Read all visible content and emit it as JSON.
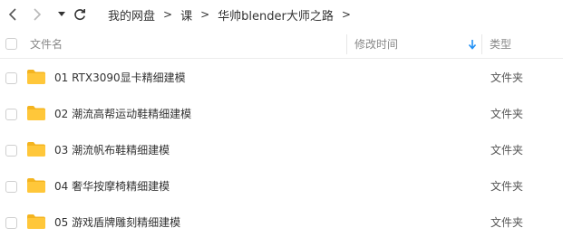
{
  "nav": {
    "back_icon": "chevron-left-icon",
    "forward_icon": "chevron-right-icon",
    "dropdown_icon": "caret-down-icon",
    "refresh_icon": "refresh-icon"
  },
  "breadcrumb": {
    "items": [
      "我的网盘",
      "课",
      "华帅blender大师之路"
    ],
    "separator": ">"
  },
  "columns": {
    "name": "文件名",
    "modified": "修改时间",
    "type": "类型",
    "sort_icon": "sort-down-arrow-icon",
    "sort_color": "#1e8ff5"
  },
  "files": [
    {
      "name": "01 RTX3090显卡精细建模",
      "type": "文件夹"
    },
    {
      "name": "02 潮流高帮运动鞋精细建模",
      "type": "文件夹"
    },
    {
      "name": "03 潮流帆布鞋精细建模",
      "type": "文件夹"
    },
    {
      "name": "04 奢华按摩椅精细建模",
      "type": "文件夹"
    },
    {
      "name": "05 游戏盾牌雕刻精细建模",
      "type": "文件夹"
    }
  ],
  "colors": {
    "folder": "#ffc73a",
    "folder_back": "#f4b41f"
  }
}
